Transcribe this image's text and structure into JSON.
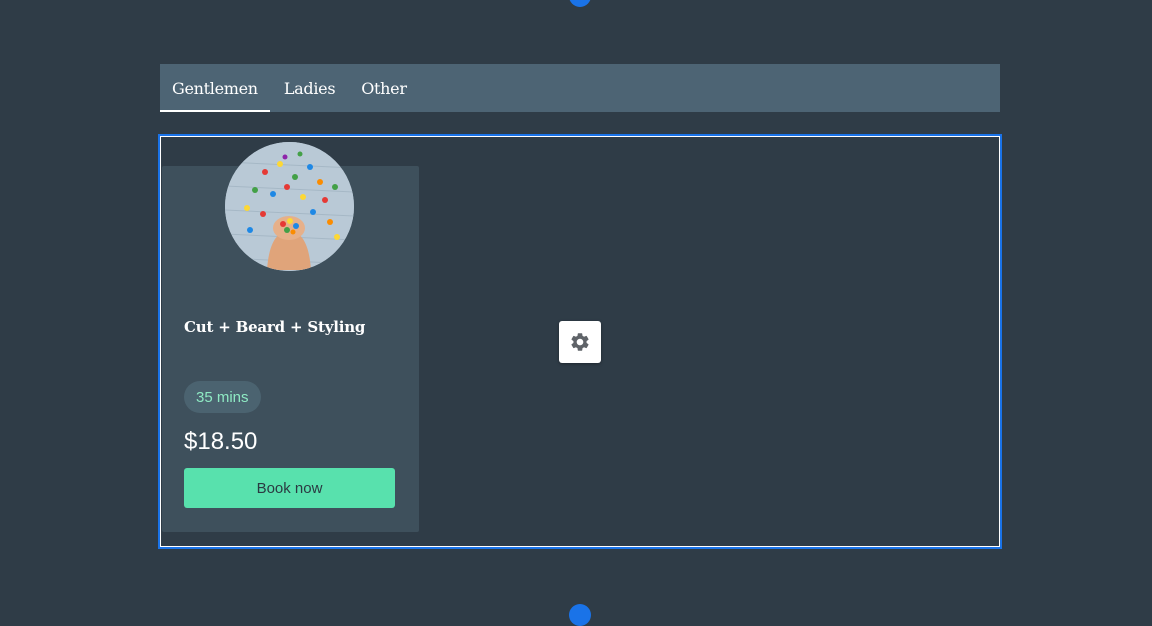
{
  "tabs": [
    {
      "label": "Gentlemen",
      "active": true
    },
    {
      "label": "Ladies",
      "active": false
    },
    {
      "label": "Other",
      "active": false
    }
  ],
  "service": {
    "title": "Cut + Beard + Styling",
    "duration": "35 mins",
    "price": "$18.50",
    "book_label": "Book now",
    "image_icon": "candy-hands-photo"
  },
  "editor": {
    "settings_icon": "gear-icon",
    "handle_color": "#1a73e8"
  },
  "colors": {
    "background": "#2f3c47",
    "tabbar": "#4d6474",
    "card": "#3e505c",
    "accent_button": "#58e1ad",
    "pill_text": "#8ee9c3",
    "selection": "#1a73e8"
  }
}
